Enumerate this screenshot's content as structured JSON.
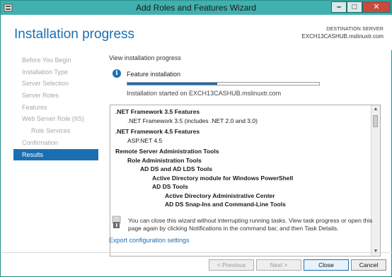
{
  "window": {
    "title": "Add Roles and Features Wizard"
  },
  "header": {
    "page_title": "Installation progress",
    "destination_label": "DESTINATION SERVER",
    "destination_server": "EXCH13CASHUB.mslinuxtr.com"
  },
  "sidebar": {
    "items": [
      {
        "label": "Before You Begin",
        "state": "disabled"
      },
      {
        "label": "Installation Type",
        "state": "disabled"
      },
      {
        "label": "Server Selection",
        "state": "disabled"
      },
      {
        "label": "Server Roles",
        "state": "disabled"
      },
      {
        "label": "Features",
        "state": "disabled"
      },
      {
        "label": "Web Server Role (IIS)",
        "state": "disabled"
      },
      {
        "label": "Role Services",
        "state": "disabled"
      },
      {
        "label": "Confirmation",
        "state": "disabled"
      },
      {
        "label": "Results",
        "state": "active"
      }
    ]
  },
  "main": {
    "section_label": "View installation progress",
    "feature_label": "Feature installation",
    "progress_fraction": 0.47,
    "progress_status": "Installation started on EXCH13CASHUB.mslinuxtr.com",
    "results": [
      ".NET Framework 3.5 Features",
      ".NET Framework 3.5 (includes .NET 2.0 and 3.0)",
      ".NET Framework 4.5 Features",
      "ASP.NET 4.5",
      "Remote Server Administration Tools",
      "Role Administration Tools",
      "AD DS and AD LDS Tools",
      "Active Directory module for Windows PowerShell",
      "AD DS Tools",
      "Active Directory Administrative Center",
      "AD DS Snap-Ins and Command-Line Tools"
    ],
    "notice": "You can close this wizard without interrupting running tasks. View task progress or open this page again by clicking Notifications in the command bar, and then Task Details.",
    "export_link": "Export configuration settings"
  },
  "footer": {
    "previous": "< Previous",
    "next": "Next >",
    "close": "Close",
    "cancel": "Cancel"
  },
  "colors": {
    "accent": "#1a6fb3",
    "titlebar": "#40b1ae",
    "close_button": "#c94a3b"
  }
}
